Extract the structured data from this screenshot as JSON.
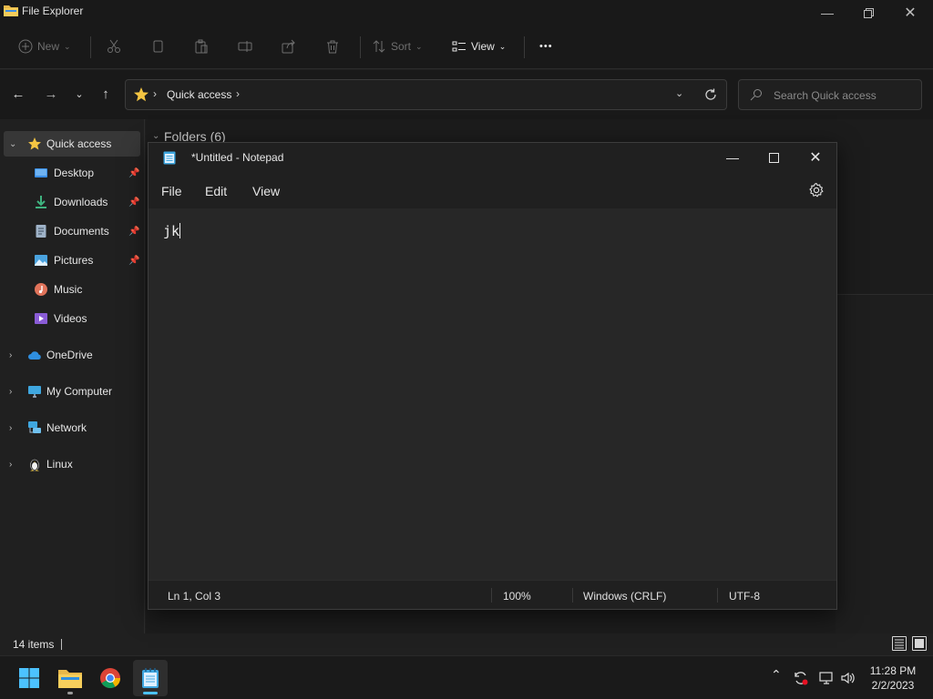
{
  "explorer": {
    "title": "File Explorer",
    "toolbar": {
      "new_label": "New",
      "sort_label": "Sort",
      "view_label": "View",
      "more_label": "•••"
    },
    "address": {
      "location": "Quick access"
    },
    "search": {
      "placeholder": "Search Quick access"
    },
    "sidebar": {
      "items": [
        {
          "label": "Quick access",
          "icon": "star-icon",
          "color": "#f4c542"
        },
        {
          "label": "Desktop",
          "icon": "desktop-icon",
          "color": "#3a8ee6",
          "pinned": true
        },
        {
          "label": "Downloads",
          "icon": "download-icon",
          "color": "#3fb27f",
          "pinned": true
        },
        {
          "label": "Documents",
          "icon": "document-icon",
          "color": "#9fb3c8",
          "pinned": true
        },
        {
          "label": "Pictures",
          "icon": "picture-icon",
          "color": "#4aa3df",
          "pinned": true
        },
        {
          "label": "Music",
          "icon": "music-icon",
          "color": "#e0735a"
        },
        {
          "label": "Videos",
          "icon": "video-icon",
          "color": "#8a5cd6"
        },
        {
          "label": "OneDrive",
          "icon": "cloud-icon",
          "color": "#2f8fe0"
        },
        {
          "label": "My Computer",
          "icon": "monitor-icon",
          "color": "#3fa7e0"
        },
        {
          "label": "Network",
          "icon": "network-icon",
          "color": "#3fa7e0"
        },
        {
          "label": "Linux",
          "icon": "linux-icon",
          "color": "#e8c03a"
        }
      ]
    },
    "content": {
      "folders_heading": "Folders (6)"
    },
    "status": {
      "item_count": "14 items"
    }
  },
  "notepad": {
    "title": "*Untitled - Notepad",
    "menu": {
      "file": "File",
      "edit": "Edit",
      "view": "View"
    },
    "text": "jk",
    "status": {
      "position": "Ln 1, Col 3",
      "zoom": "100%",
      "line_ending": "Windows (CRLF)",
      "encoding": "UTF-8"
    }
  },
  "taskbar": {
    "apps": [
      "start-icon",
      "file-explorer-icon",
      "chrome-icon",
      "notepad-icon"
    ],
    "clock": {
      "time": "11:28 PM",
      "date": "2/2/2023"
    }
  }
}
